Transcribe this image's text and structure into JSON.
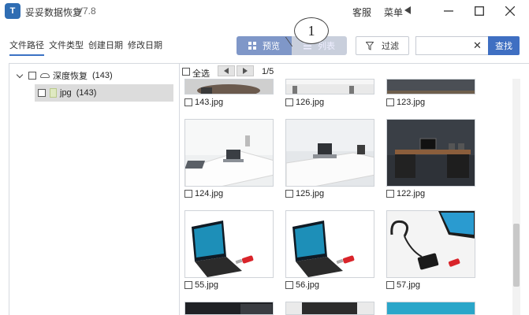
{
  "app": {
    "title": "妥妥数据恢复",
    "version": "V7.8",
    "help": "客服",
    "menu": "菜单",
    "logo": "T"
  },
  "tabs": [
    {
      "label": "文件路径",
      "active": true
    },
    {
      "label": "文件类型",
      "active": false
    },
    {
      "label": "创建日期",
      "active": false
    },
    {
      "label": "修改日期",
      "active": false
    }
  ],
  "view": {
    "preview": "预览",
    "list": "列表"
  },
  "callout": {
    "number": "1"
  },
  "filter": {
    "label": "过滤"
  },
  "search": {
    "placeholder": "",
    "button": "查找",
    "clear": "✕"
  },
  "tree": {
    "root": {
      "label": "深度恢复",
      "count": "(143)"
    },
    "child": {
      "label": "jpg",
      "count": "(143)"
    }
  },
  "grid": {
    "select_all": "全选",
    "page": "1/5",
    "row0": [
      "143.jpg",
      "126.jpg",
      "123.jpg"
    ],
    "row1": [
      "124.jpg",
      "125.jpg",
      "122.jpg"
    ],
    "row2": [
      "55.jpg",
      "56.jpg",
      "57.jpg"
    ]
  },
  "colors": {
    "accent": "#3f6fc2",
    "toggle_on": "#7f97c8",
    "toggle_off": "#c9cfdc"
  }
}
